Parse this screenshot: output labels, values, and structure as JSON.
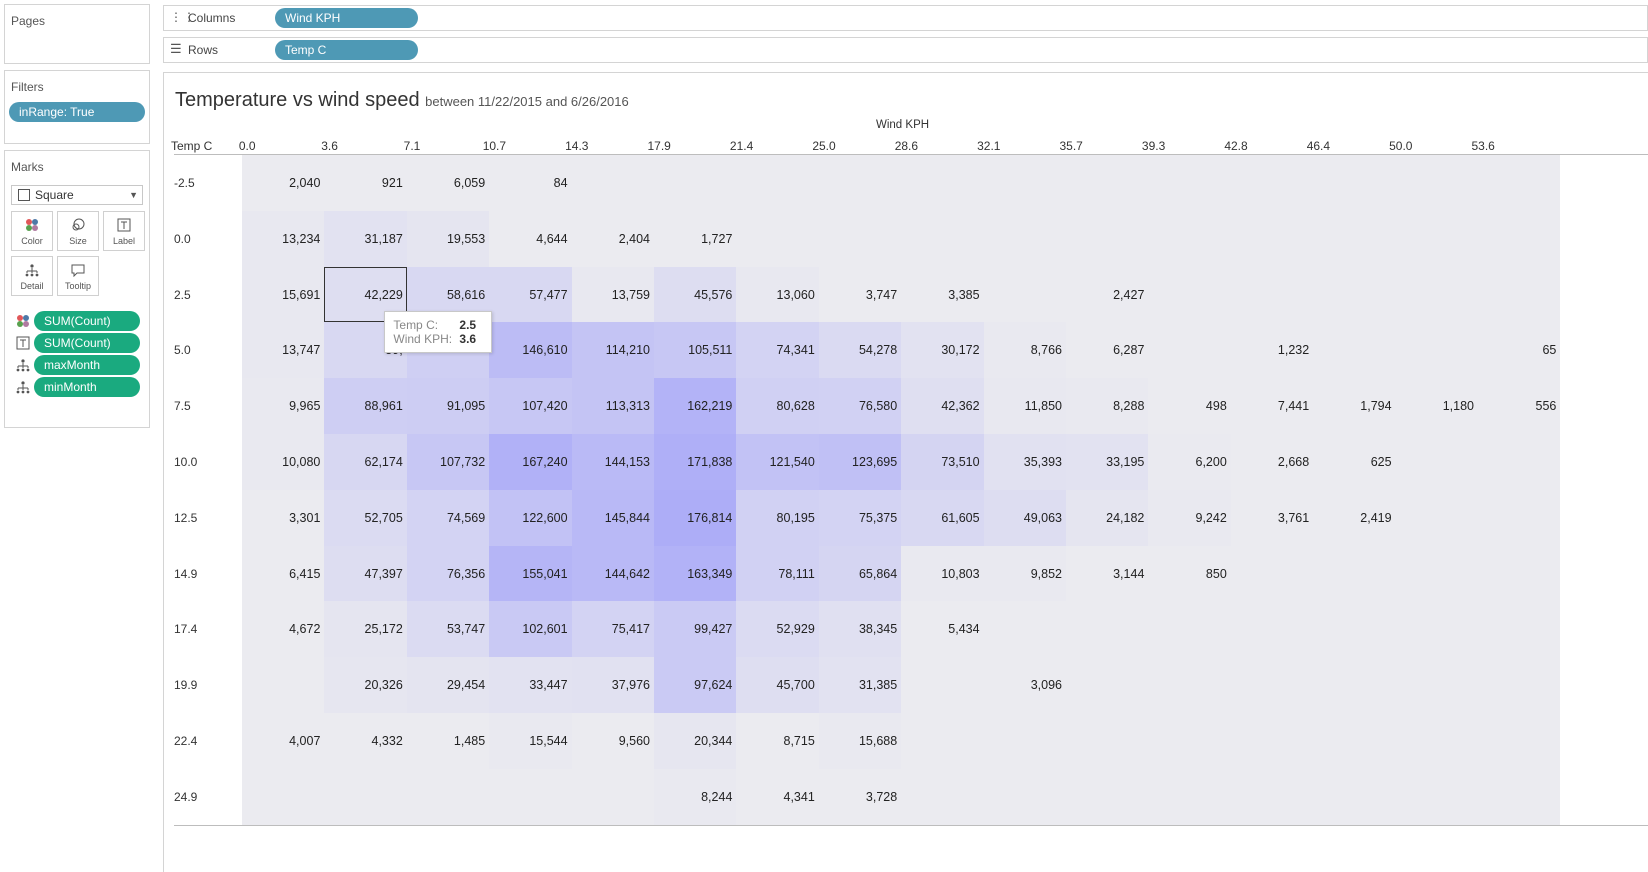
{
  "pages_panel": {
    "title": "Pages"
  },
  "filters_panel": {
    "title": "Filters",
    "pills": [
      "inRange: True"
    ]
  },
  "marks_panel": {
    "title": "Marks",
    "mark_type": "Square",
    "cards": [
      "Color",
      "Size",
      "Label",
      "Detail",
      "Tooltip"
    ],
    "fields": [
      {
        "icon": "color-icon",
        "label": "SUM(Count)"
      },
      {
        "icon": "label-icon",
        "label": "SUM(Count)"
      },
      {
        "icon": "detail-icon",
        "label": "maxMonth"
      },
      {
        "icon": "detail-icon",
        "label": "minMonth"
      }
    ]
  },
  "shelves": {
    "columns_label": "Columns",
    "columns_pill": "Wind KPH",
    "rows_label": "Rows",
    "rows_pill": "Temp C"
  },
  "view": {
    "title": "Temperature vs wind speed",
    "subtitle": "between 11/22/2015 and 6/26/2016",
    "col_axis_title": "Wind KPH",
    "row_axis_title": "Temp C"
  },
  "colors": {
    "pill_blue": "#4e99b5",
    "pill_green": "#1aaa7f",
    "heat_low": "#efefef",
    "heat_high": "#a8a8f8"
  },
  "chart_data": {
    "type": "heatmap",
    "x_label": "Wind KPH",
    "y_label": "Temp C",
    "x": [
      "0.0",
      "3.6",
      "7.1",
      "10.7",
      "14.3",
      "17.9",
      "21.4",
      "25.0",
      "28.6",
      "32.1",
      "35.7",
      "39.3",
      "42.8",
      "46.4",
      "50.0",
      "53.6"
    ],
    "y": [
      "-2.5",
      "0.0",
      "2.5",
      "5.0",
      "7.5",
      "10.0",
      "12.5",
      "14.9",
      "17.4",
      "19.9",
      "22.4",
      "24.9"
    ],
    "values": [
      [
        2040,
        921,
        6059,
        84,
        null,
        null,
        null,
        null,
        null,
        null,
        null,
        null,
        null,
        null,
        null,
        null
      ],
      [
        13234,
        31187,
        19553,
        4644,
        2404,
        1727,
        null,
        null,
        null,
        null,
        null,
        null,
        null,
        null,
        null,
        null
      ],
      [
        15691,
        42229,
        58616,
        57477,
        13759,
        45576,
        13060,
        3747,
        3385,
        null,
        2427,
        null,
        null,
        null,
        null,
        null
      ],
      [
        13747,
        59,
        null,
        146610,
        114210,
        105511,
        74341,
        54278,
        30172,
        8766,
        6287,
        null,
        1232,
        null,
        null,
        65
      ],
      [
        9965,
        88961,
        91095,
        107420,
        113313,
        162219,
        80628,
        76580,
        42362,
        11850,
        8288,
        498,
        7441,
        1794,
        1180,
        556
      ],
      [
        10080,
        62174,
        107732,
        167240,
        144153,
        171838,
        121540,
        123695,
        73510,
        35393,
        33195,
        6200,
        2668,
        625,
        null,
        null
      ],
      [
        3301,
        52705,
        74569,
        122600,
        145844,
        176814,
        80195,
        75375,
        61605,
        49063,
        24182,
        9242,
        3761,
        2419,
        null,
        null
      ],
      [
        6415,
        47397,
        76356,
        155041,
        144642,
        163349,
        78111,
        65864,
        10803,
        9852,
        3144,
        850,
        null,
        null,
        null,
        null
      ],
      [
        4672,
        25172,
        53747,
        102601,
        75417,
        99427,
        52929,
        38345,
        5434,
        null,
        null,
        null,
        null,
        null,
        null,
        null
      ],
      [
        null,
        20326,
        29454,
        33447,
        37976,
        97624,
        45700,
        31385,
        null,
        3096,
        null,
        null,
        null,
        null,
        null,
        null
      ],
      [
        4007,
        4332,
        1485,
        15544,
        9560,
        20344,
        8715,
        15688,
        null,
        null,
        null,
        null,
        null,
        null,
        null,
        null
      ],
      [
        null,
        null,
        null,
        null,
        null,
        8244,
        4341,
        3728,
        null,
        null,
        null,
        null,
        null,
        null,
        null,
        null
      ]
    ],
    "display_labels": [
      [
        "2,040",
        "921",
        "6,059",
        "84",
        "",
        "",
        "",
        "",
        "",
        "",
        "",
        "",
        "",
        "",
        "",
        ""
      ],
      [
        "13,234",
        "31,187",
        "19,553",
        "4,644",
        "2,404",
        "1,727",
        "",
        "",
        "",
        "",
        "",
        "",
        "",
        "",
        "",
        ""
      ],
      [
        "15,691",
        "42,229",
        "58,616",
        "57,477",
        "13,759",
        "45,576",
        "13,060",
        "3,747",
        "3,385",
        "",
        "2,427",
        "",
        "",
        "",
        "",
        ""
      ],
      [
        "13,747",
        "59,",
        "",
        "146,610",
        "114,210",
        "105,511",
        "74,341",
        "54,278",
        "30,172",
        "8,766",
        "6,287",
        "",
        "1,232",
        "",
        "",
        "65"
      ],
      [
        "9,965",
        "88,961",
        "91,095",
        "107,420",
        "113,313",
        "162,219",
        "80,628",
        "76,580",
        "42,362",
        "11,850",
        "8,288",
        "498",
        "7,441",
        "1,794",
        "1,180",
        "556"
      ],
      [
        "10,080",
        "62,174",
        "107,732",
        "167,240",
        "144,153",
        "171,838",
        "121,540",
        "123,695",
        "73,510",
        "35,393",
        "33,195",
        "6,200",
        "2,668",
        "625",
        "",
        ""
      ],
      [
        "3,301",
        "52,705",
        "74,569",
        "122,600",
        "145,844",
        "176,814",
        "80,195",
        "75,375",
        "61,605",
        "49,063",
        "24,182",
        "9,242",
        "3,761",
        "2,419",
        "",
        ""
      ],
      [
        "6,415",
        "47,397",
        "76,356",
        "155,041",
        "144,642",
        "163,349",
        "78,111",
        "65,864",
        "10,803",
        "9,852",
        "3,144",
        "850",
        "",
        "",
        "",
        ""
      ],
      [
        "4,672",
        "25,172",
        "53,747",
        "102,601",
        "75,417",
        "99,427",
        "52,929",
        "38,345",
        "5,434",
        "",
        "",
        "",
        "",
        "",
        "",
        ""
      ],
      [
        "",
        "20,326",
        "29,454",
        "33,447",
        "37,976",
        "97,624",
        "45,700",
        "31,385",
        "",
        "3,096",
        "",
        "",
        "",
        "",
        "",
        ""
      ],
      [
        "4,007",
        "4,332",
        "1,485",
        "15,544",
        "9,560",
        "20,344",
        "8,715",
        "15,688",
        "",
        "",
        "",
        "",
        "",
        "",
        "",
        ""
      ],
      [
        "",
        "",
        "",
        "",
        "",
        "8,244",
        "4,341",
        "3,728",
        "",
        "",
        "",
        "",
        "",
        "",
        "",
        ""
      ]
    ],
    "cell_shades": [
      [
        0.06,
        0.06,
        0.06,
        0.06,
        0.06,
        0.06,
        0.06,
        0.06,
        0.06,
        0.06,
        0.06,
        0.06,
        0.06,
        0.06,
        0.06,
        0.06
      ],
      [
        0.1,
        0.18,
        0.14,
        0.06,
        0.06,
        0.06,
        0.06,
        0.06,
        0.06,
        0.06,
        0.06,
        0.06,
        0.06,
        0.06,
        0.06,
        0.06
      ],
      [
        0.1,
        0.24,
        0.32,
        0.32,
        0.1,
        0.26,
        0.1,
        0.06,
        0.06,
        0.06,
        0.06,
        0.06,
        0.06,
        0.06,
        0.06,
        0.06
      ],
      [
        0.1,
        0.32,
        0.45,
        0.72,
        0.6,
        0.56,
        0.4,
        0.3,
        0.18,
        0.08,
        0.06,
        0.06,
        0.06,
        0.06,
        0.06,
        0.06
      ],
      [
        0.08,
        0.46,
        0.48,
        0.56,
        0.6,
        0.85,
        0.44,
        0.42,
        0.22,
        0.1,
        0.08,
        0.06,
        0.06,
        0.06,
        0.06,
        0.06
      ],
      [
        0.08,
        0.34,
        0.56,
        0.88,
        0.75,
        0.9,
        0.64,
        0.66,
        0.38,
        0.2,
        0.18,
        0.07,
        0.06,
        0.06,
        0.06,
        0.06
      ],
      [
        0.06,
        0.28,
        0.4,
        0.64,
        0.76,
        0.93,
        0.42,
        0.4,
        0.33,
        0.26,
        0.14,
        0.08,
        0.06,
        0.06,
        0.06,
        0.06
      ],
      [
        0.06,
        0.25,
        0.4,
        0.82,
        0.76,
        0.86,
        0.42,
        0.36,
        0.08,
        0.08,
        0.06,
        0.06,
        0.06,
        0.06,
        0.06,
        0.06
      ],
      [
        0.06,
        0.14,
        0.28,
        0.54,
        0.4,
        0.52,
        0.28,
        0.21,
        0.06,
        0.06,
        0.06,
        0.06,
        0.06,
        0.06,
        0.06,
        0.06
      ],
      [
        0.06,
        0.12,
        0.16,
        0.18,
        0.2,
        0.52,
        0.24,
        0.18,
        0.06,
        0.06,
        0.06,
        0.06,
        0.06,
        0.06,
        0.06,
        0.06
      ],
      [
        0.06,
        0.06,
        0.06,
        0.09,
        0.06,
        0.12,
        0.06,
        0.09,
        0.06,
        0.06,
        0.06,
        0.06,
        0.06,
        0.06,
        0.06,
        0.06
      ],
      [
        0.06,
        0.06,
        0.06,
        0.06,
        0.06,
        0.08,
        0.06,
        0.06,
        0.06,
        0.06,
        0.06,
        0.06,
        0.06,
        0.06,
        0.06,
        0.06
      ]
    ]
  },
  "tooltip": {
    "row_key": "Temp C:",
    "row_val": "2.5",
    "col_key": "Wind KPH:",
    "col_val": "3.6"
  }
}
